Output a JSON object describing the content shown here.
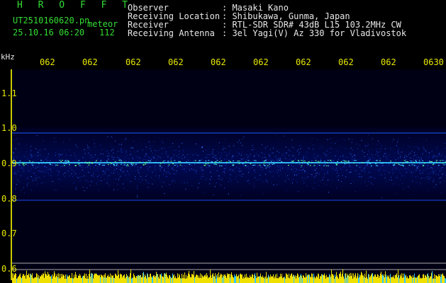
{
  "header": {
    "brand": "H R O F F T",
    "file_name": "UT2510160620.pn",
    "file_type": "meteor",
    "date_time": "25.10.16 06:20",
    "count": "112",
    "rows": [
      {
        "label": "Observer",
        "value": ": Masaki Kano"
      },
      {
        "label": "Receiving Location",
        "value": ": Shibukawa, Gunma, Japan"
      },
      {
        "label": "Receiver",
        "value": ": RTL-SDR SDR# 43dB L15 103.2MHz CW"
      },
      {
        "label": "Receiving Antenna",
        "value": ": 3el Yagi(V) Az 330 for Vladivostok"
      }
    ]
  },
  "axis": {
    "unit": "kHz",
    "time_ticks": [
      "062",
      "062",
      "062",
      "062",
      "062",
      "062",
      "062",
      "062",
      "062",
      "0630"
    ],
    "freq_ticks": [
      "1.1",
      "1.0",
      "0.9",
      "0.8",
      "0.7",
      "0.6"
    ]
  },
  "colors": {
    "header_green": "#33dd33",
    "label_white": "#e8e8e8",
    "axis_yellow": "#e8e800",
    "spectrum_bg": "#000033",
    "meteor_line": "#30c8ff",
    "noise_floor": "#f0e000"
  }
}
